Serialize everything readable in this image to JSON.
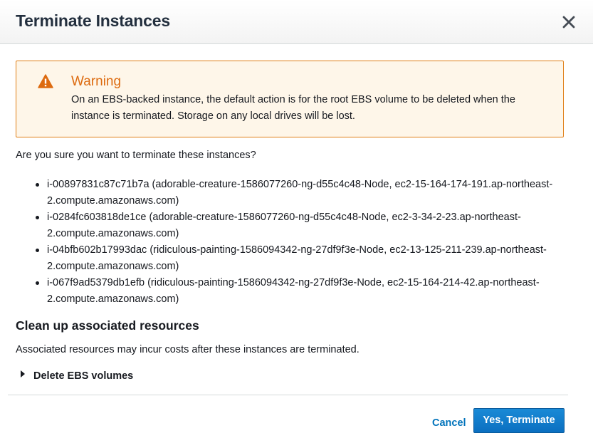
{
  "dialog": {
    "title": "Terminate Instances",
    "close_icon": "close-icon"
  },
  "warning": {
    "icon": "warning-triangle-icon",
    "title": "Warning",
    "message": "On an EBS-backed instance, the default action is for the root EBS volume to be deleted when the instance is terminated. Storage on any local drives will be lost.",
    "accent_color": "#dd6b10",
    "border_color": "#e07f17",
    "background_color": "#fef6e9"
  },
  "confirm_text": "Are you sure you want to terminate these instances?",
  "instances": [
    "i-00897831c87c71b7a (adorable-creature-1586077260-ng-d55c4c48-Node, ec2-15-164-174-191.ap-northeast-2.compute.amazonaws.com)",
    "i-0284fc603818de1ce (adorable-creature-1586077260-ng-d55c4c48-Node, ec2-3-34-2-23.ap-northeast-2.compute.amazonaws.com)",
    "i-04bfb602b17993dac (ridiculous-painting-1586094342-ng-27df9f3e-Node, ec2-13-125-211-239.ap-northeast-2.compute.amazonaws.com)",
    "i-067f9ad5379db1efb (ridiculous-painting-1586094342-ng-27df9f3e-Node, ec2-15-164-214-42.ap-northeast-2.compute.amazonaws.com)"
  ],
  "cleanup": {
    "title": "Clean up associated resources",
    "description": "Associated resources may incur costs after these instances are terminated.",
    "expander_label": "Delete EBS volumes",
    "expander_icon": "caret-right-icon"
  },
  "footer": {
    "cancel_label": "Cancel",
    "confirm_label": "Yes, Terminate",
    "primary_color": "#0b6fc0",
    "link_color": "#0073bb"
  }
}
